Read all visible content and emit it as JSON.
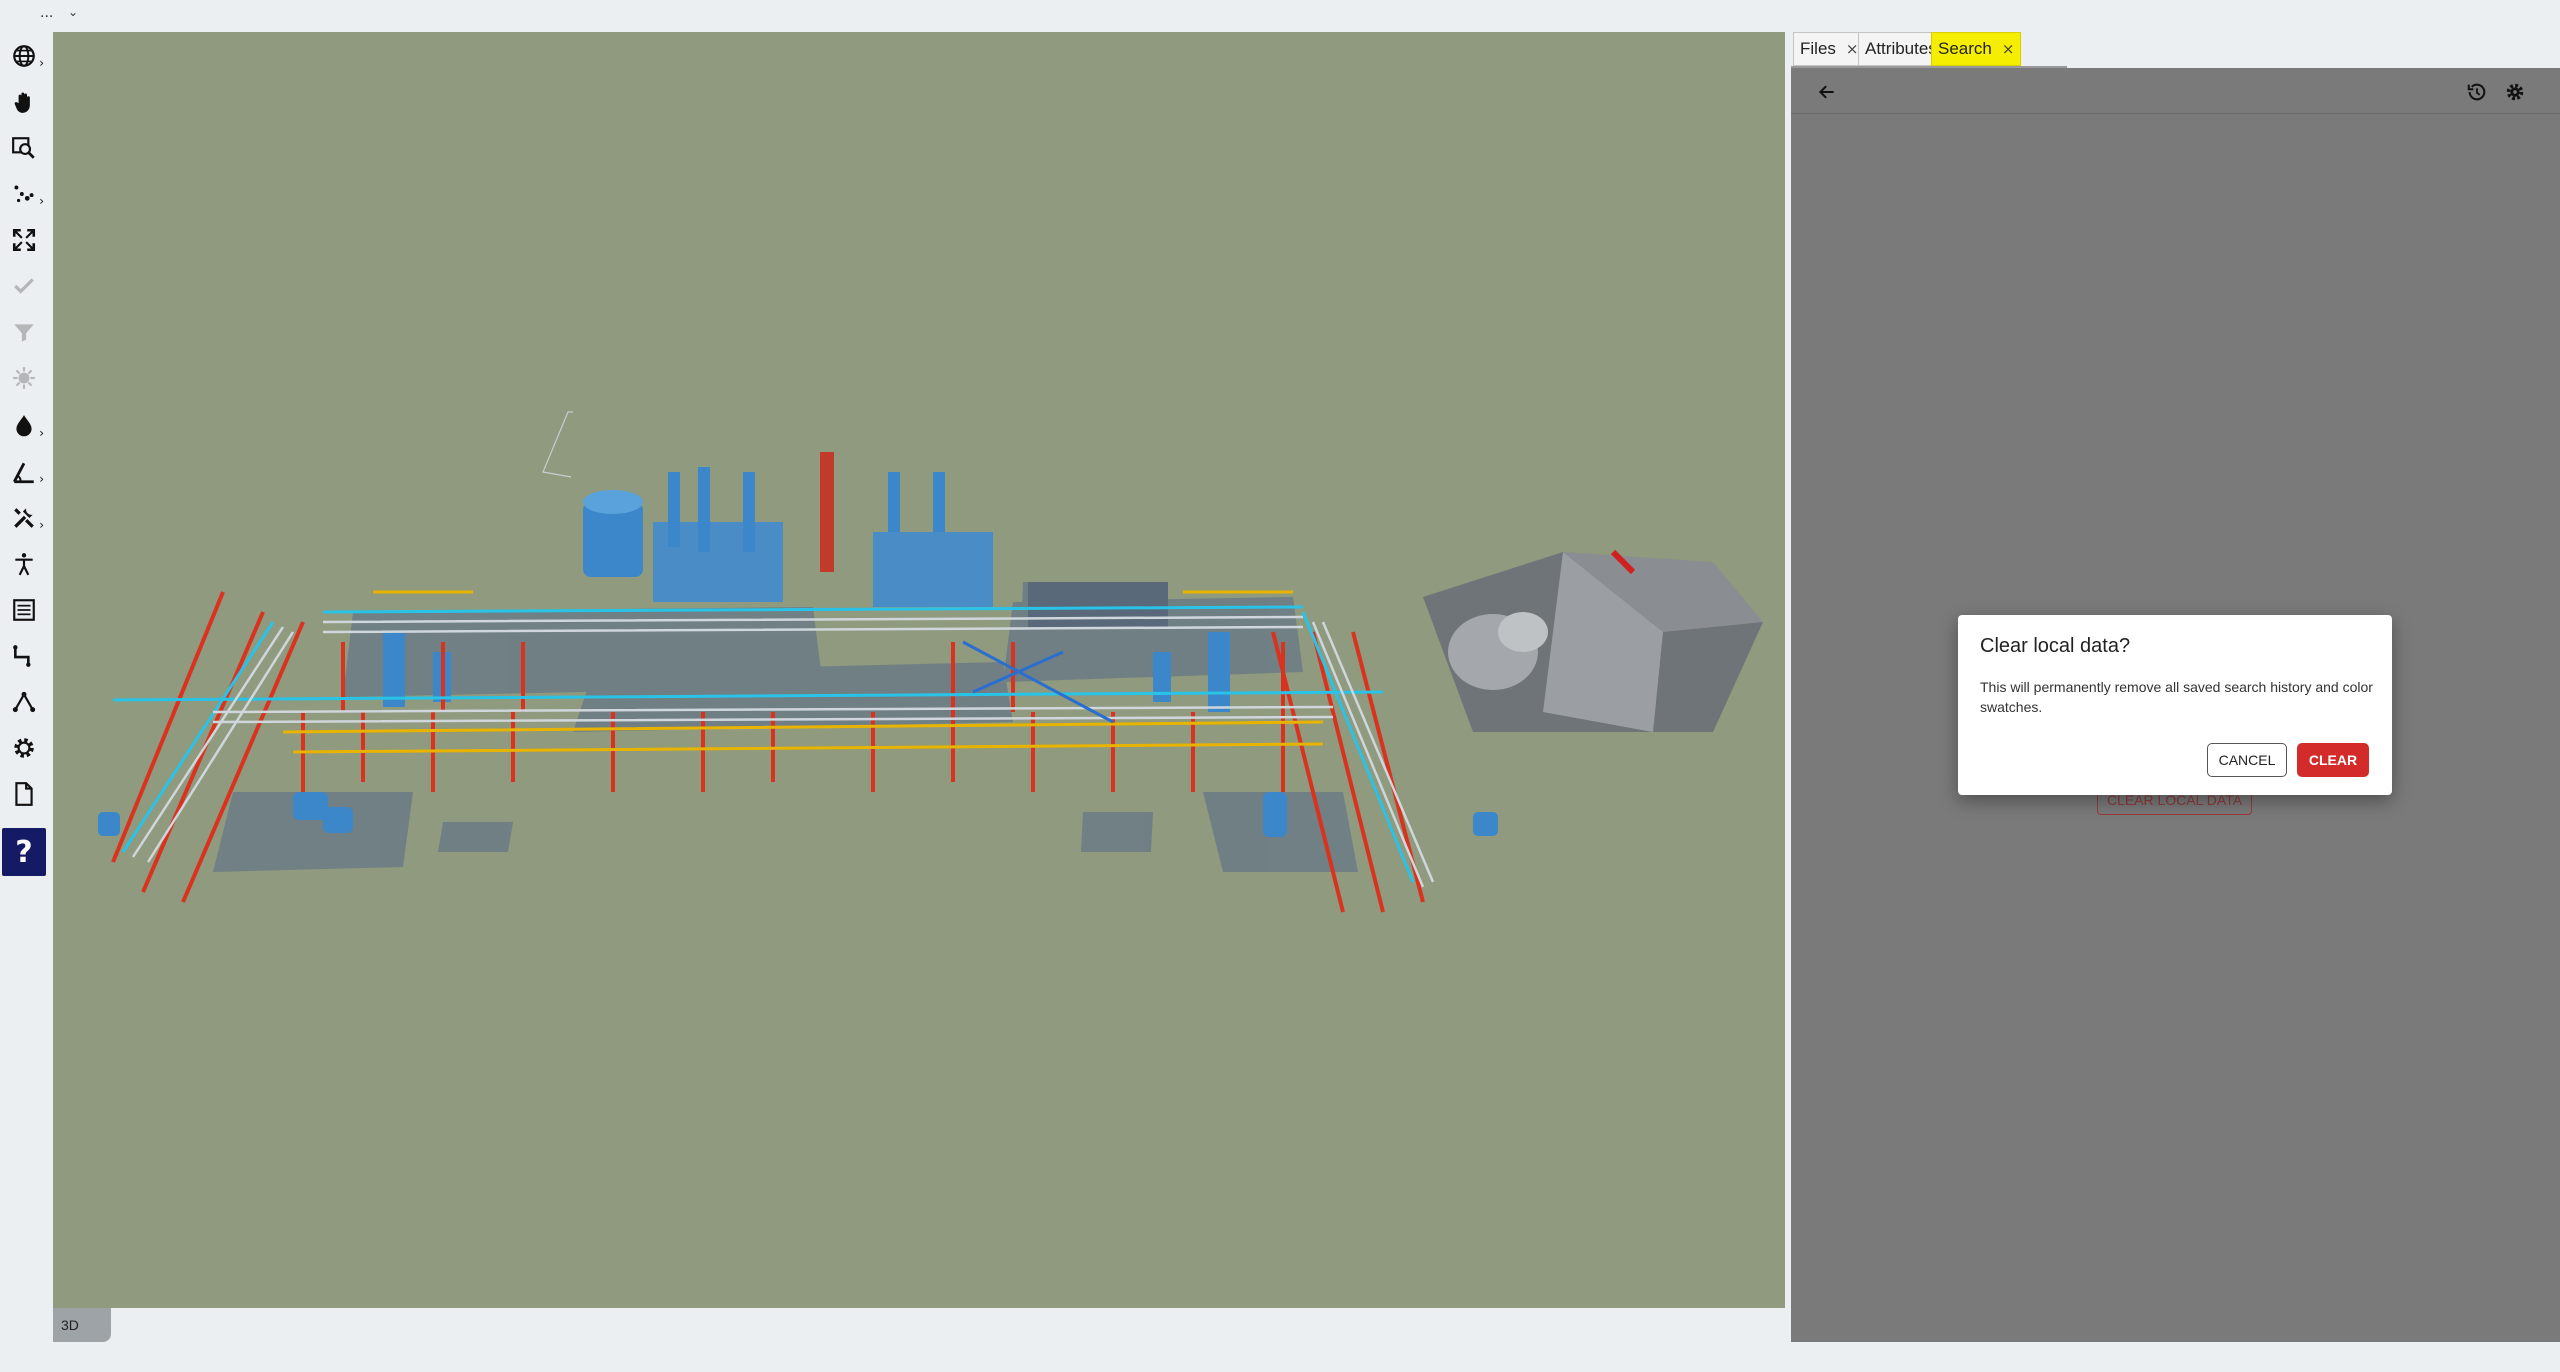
{
  "topbar": {
    "menu": "...",
    "chevron": "⌄"
  },
  "toolbar": {
    "items": [
      {
        "name": "globe-icon",
        "sub": "›"
      },
      {
        "name": "pan-hand-icon",
        "sub": ""
      },
      {
        "name": "zoom-window-icon",
        "sub": ""
      },
      {
        "name": "points-icon",
        "sub": "›"
      },
      {
        "name": "fit-all-icon",
        "sub": ""
      },
      {
        "name": "checkmark-icon",
        "sub": ""
      },
      {
        "name": "filter-icon",
        "sub": ""
      },
      {
        "name": "starburst-icon",
        "sub": ""
      },
      {
        "name": "color-drop-icon",
        "sub": "›"
      },
      {
        "name": "measure-angle-icon",
        "sub": "›"
      },
      {
        "name": "tools-icon",
        "sub": "›"
      },
      {
        "name": "person-icon",
        "sub": ""
      },
      {
        "name": "list-icon",
        "sub": ""
      },
      {
        "name": "route-icon",
        "sub": ""
      },
      {
        "name": "network-icon",
        "sub": ""
      },
      {
        "name": "settings-gear-icon",
        "sub": ""
      },
      {
        "name": "document-icon",
        "sub": ""
      }
    ],
    "help_label": "?"
  },
  "viewport": {
    "mode_label": "3D",
    "background": "#8f9a7e"
  },
  "panel": {
    "tabs": [
      {
        "label": "Files",
        "close": "×",
        "active": false
      },
      {
        "label": "Attributes",
        "close": "",
        "active": false
      },
      {
        "label": "Search",
        "close": "×",
        "active": true
      }
    ],
    "behind_button": "CLEAR LOCAL DATA"
  },
  "dialog": {
    "title": "Clear local data?",
    "message": "This will permanently remove all saved search history and color swatches.",
    "cancel_label": "CANCEL",
    "clear_label": "CLEAR",
    "clear_color": "#d32a2a"
  }
}
